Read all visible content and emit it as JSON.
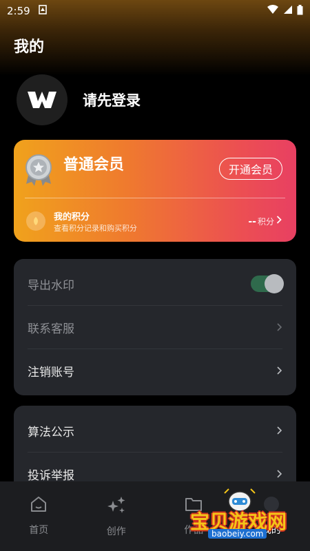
{
  "status_bar": {
    "time": "2:59"
  },
  "page": {
    "title": "我的"
  },
  "profile": {
    "login_prompt": "请先登录"
  },
  "vip_card": {
    "title": "普通会员",
    "open_button": "开通会员",
    "points_title": "我的积分",
    "points_subtitle": "查看积分记录和购买积分",
    "points_value": "--",
    "points_unit": "积分",
    "colors": {
      "gradient_start": "#f0a21c",
      "gradient_end": "#e84062"
    }
  },
  "settings_group_1": {
    "export_watermark": "导出水印",
    "export_watermark_enabled": true,
    "contact_support": "联系客服",
    "cancel_account": "注销账号"
  },
  "settings_group_2": {
    "algorithm_disclosure": "算法公示",
    "report_complaint": "投诉举报"
  },
  "tabbar": {
    "home": "首页",
    "create": "创作",
    "works": "作品",
    "mine": "我的"
  },
  "watermark": {
    "text": "宝贝游戏网",
    "url": "baobeiy.com"
  }
}
